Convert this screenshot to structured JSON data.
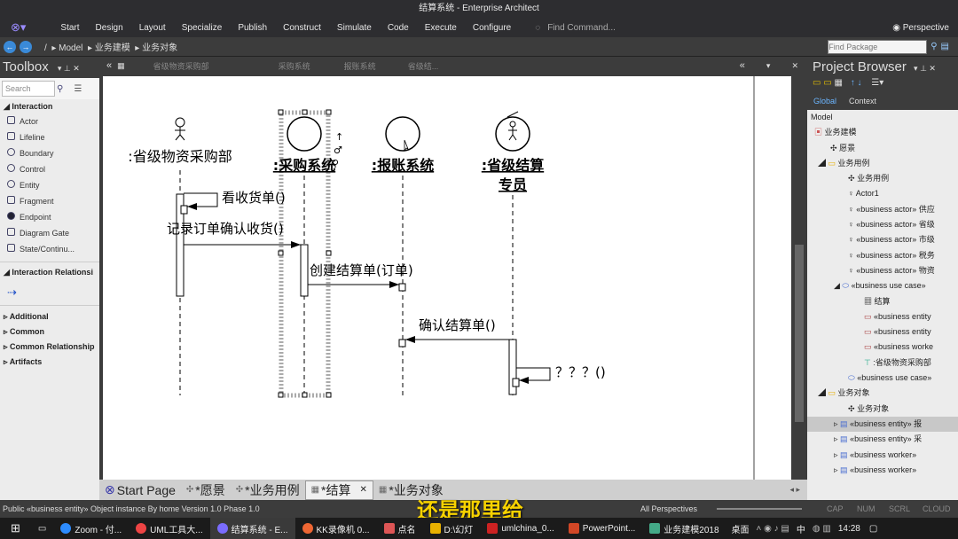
{
  "window": {
    "title": "结算系统 - Enterprise Architect"
  },
  "menu": [
    "Start",
    "Design",
    "Layout",
    "Specialize",
    "Publish",
    "Construct",
    "Simulate",
    "Code",
    "Execute",
    "Configure"
  ],
  "find_command": "Find Command...",
  "perspective": "Perspective",
  "breadcrumb": [
    "/",
    "Model",
    "业务建模",
    "业务对象"
  ],
  "find_package_placeholder": "Find Package",
  "toolbox": {
    "title": "Toolbox",
    "search_placeholder": "Search",
    "section_interaction": "Interaction",
    "items": [
      "Actor",
      "Lifeline",
      "Boundary",
      "Control",
      "Entity",
      "Fragment",
      "Endpoint",
      "Diagram Gate",
      "State/Continu..."
    ],
    "section_relationships": "Interaction Relationsi",
    "collapsed": [
      "Additional",
      "Common",
      "Common Relationship",
      "Artifacts"
    ]
  },
  "diagram_tabs": [
    "省级物资采购部",
    "采购系统",
    "报账系统",
    "省级结..."
  ],
  "lifelines": {
    "l1": ":省级物资采购部",
    "l2": ":采购系统",
    "l3": ":报账系统",
    "l4a": ":省级结算",
    "l4b": "专员"
  },
  "messages": {
    "m1": "看收货单()",
    "m2": "记录订单确认收货()",
    "m3": "创建结算单(订单)",
    "m4": "确认结算单()",
    "m5": "？？？()"
  },
  "bottom_tabs": [
    "Start Page",
    "*愿景",
    "*业务用例",
    "*结算",
    "*业务对象"
  ],
  "project_browser": {
    "title": "Project Browser",
    "tabs": [
      "Global",
      "Context"
    ],
    "tree": [
      "Model",
      "业务建模",
      "愿景",
      "业务用例",
      "业务用例",
      "Actor1",
      "«business actor» 供应",
      "«business actor» 省级",
      "«business actor» 市级",
      "«business actor» 税务",
      "«business actor» 物资",
      "«business use case» ",
      "结算",
      "«business entity",
      "«business entity",
      "«business worke",
      ":省级物资采购部",
      "«business use case» ",
      "业务对象",
      "业务对象",
      "«business entity» 报",
      "«business entity» 采",
      "«business worker» ",
      "«business worker» "
    ]
  },
  "status": {
    "left": "Public «business entity»  Object instance  By home Version 1.0  Phase 1.0",
    "perspectives": "All Perspectives",
    "flags": [
      "CAP",
      "NUM",
      "SCRL",
      "CLOUD"
    ]
  },
  "subtitle": "还是那里给",
  "taskbar": {
    "items": [
      "Zoom - 付...",
      "UML工具大...",
      "结算系统 - E...",
      "KK录像机 0...",
      "点名",
      "D:\\幻灯",
      "umlchina_0...",
      "PowerPoint...",
      "业务建模2018"
    ],
    "desktop": "桌面",
    "ime": "中",
    "time": "14:28"
  }
}
